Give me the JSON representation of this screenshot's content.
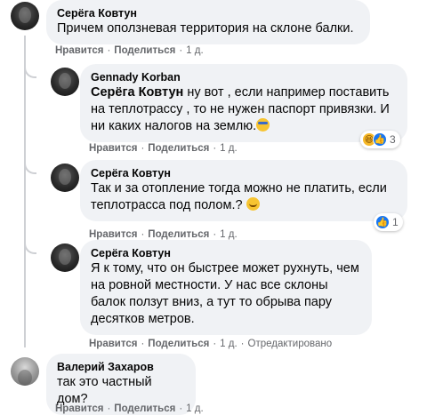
{
  "actions": {
    "like": "Нравится",
    "reply": "Поделиться",
    "dot": "·"
  },
  "comments": [
    {
      "author": "Серёга Ковтун",
      "text": "Причем оползневая территория на склоне балки.",
      "time": "1 д.",
      "avatar": "dark-profile-photo"
    },
    {
      "author": "Gennady Korban",
      "mention": "Серёга Ковтун",
      "text": " ну вот , если например поставить на теплотрассу , то не нужен паспорт привязки. И ни каких налогов на землю.",
      "emoji": "nerd-face-emoji",
      "time": "1 д.",
      "reactions": {
        "icons": [
          "haha",
          "like"
        ],
        "count": "3"
      },
      "avatar": "dark-profile-photo"
    },
    {
      "author": "Серёга Ковтун",
      "text": "Так и за отопление тогда можно не платить, если теплотрасса под полом.? ",
      "emoji": "smile-emoji",
      "time": "1 д.",
      "reactions": {
        "icons": [
          "like"
        ],
        "count": "1"
      },
      "avatar": "dark-profile-photo"
    },
    {
      "author": "Серёга Ковтун",
      "text": "Я к тому, что он быстрее может рухнуть, чем на ровной местности. У нас все склоны балок ползут вниз, а тут то обрыва пару десятков метров.",
      "time": "1 д.",
      "edited": "Отредактировано",
      "avatar": "dark-profile-photo"
    },
    {
      "author": "Валерий Захаров",
      "text": "так это частный дом?",
      "time": "1 д.",
      "avatar": "gray-profile-photo"
    }
  ]
}
